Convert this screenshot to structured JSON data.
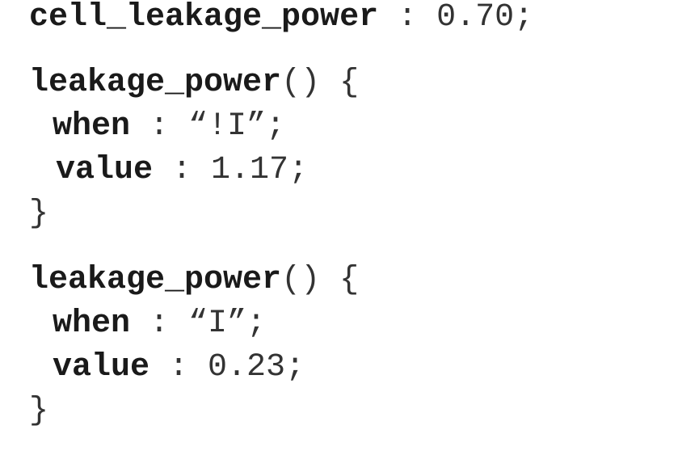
{
  "lines": {
    "cell_leakage": {
      "name": "cell_leakage_power",
      "sep": " : ",
      "value": "0.70;"
    },
    "block1": {
      "header": {
        "keyword": "leakage_power",
        "rest": "() {"
      },
      "when": {
        "keyword": "when",
        "sep": " : ",
        "value": "“!I”;"
      },
      "value": {
        "keyword": "value",
        "sep": " : ",
        "value": "1.17;"
      },
      "close": "}"
    },
    "block2": {
      "header": {
        "keyword": "leakage_power",
        "rest": "() {"
      },
      "when": {
        "keyword": "when",
        "sep": " : ",
        "value": "“I”;"
      },
      "value": {
        "keyword": "value",
        "sep": " : ",
        "value": "0.23;"
      },
      "close": "}"
    }
  }
}
